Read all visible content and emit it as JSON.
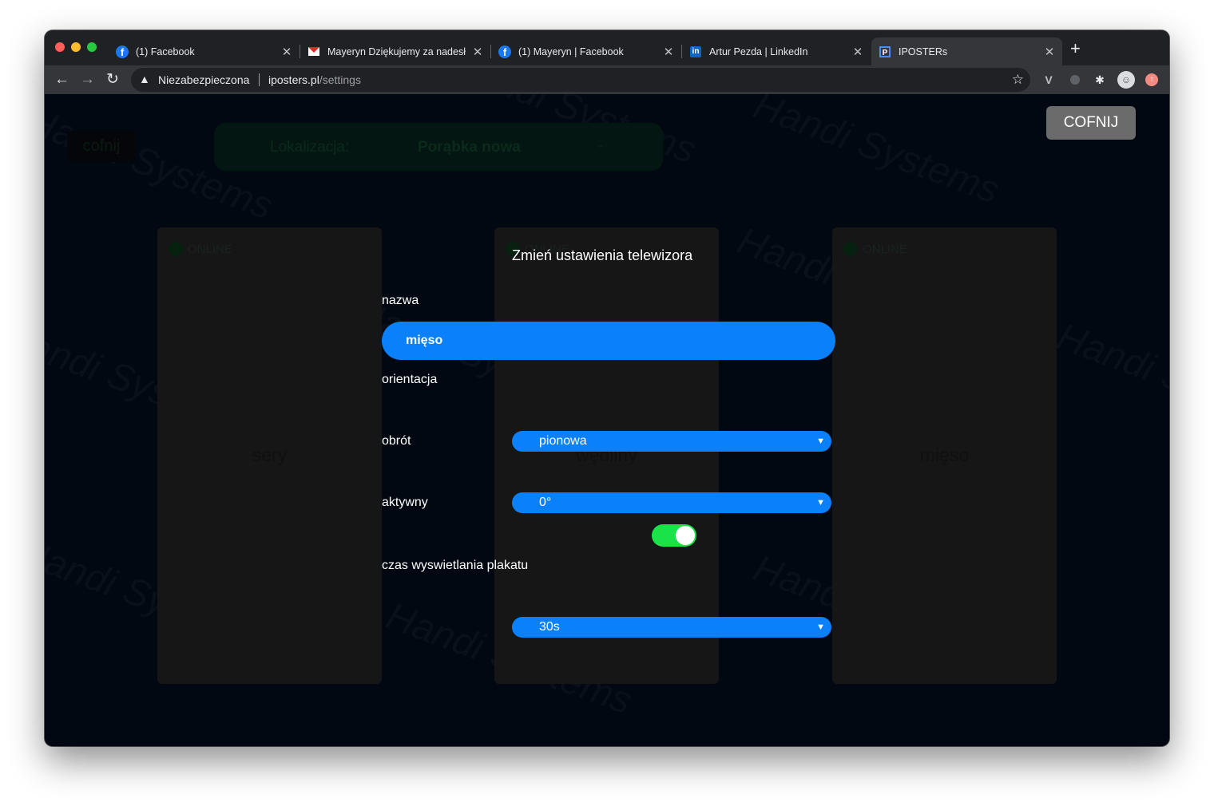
{
  "browser": {
    "tabs": [
      {
        "title": "(1) Facebook",
        "icon": "facebook-icon"
      },
      {
        "title": "Mayeryn Dziękujemy za nadesł",
        "icon": "gmail-icon"
      },
      {
        "title": "(1) Mayeryn | Facebook",
        "icon": "facebook-icon"
      },
      {
        "title": "Artur Pezda | LinkedIn",
        "icon": "linkedin-icon"
      },
      {
        "title": "IPOSTERs",
        "icon": "iposters-icon",
        "active": true
      }
    ],
    "security_label": "Niezabezpieczona",
    "url_host": "iposters.pl",
    "url_path": "/settings"
  },
  "background": {
    "back_label": "cofnij",
    "location_label": "Lokalizacja:",
    "location_value": "Porąbka nowa",
    "tvs": [
      {
        "status": "ONLINE",
        "name": "sery"
      },
      {
        "status": "ONLINE",
        "name": "wędliny"
      },
      {
        "status": "ONLINE",
        "name": "mięso"
      }
    ]
  },
  "cofnij_button": "COFNIJ",
  "modal": {
    "title": "Zmień ustawienia telewizora",
    "name_label": "nazwa",
    "name_value": "mięso",
    "orientation_label": "orientacja",
    "orientation_value": "pionowa",
    "rotation_label": "obrót",
    "rotation_value": "0°",
    "active_label": "aktywny",
    "active_on": true,
    "display_time_label": "czas wyswietlania plakatu",
    "display_time_value": "30s"
  },
  "colors": {
    "accent": "#0a80fb",
    "toggle_on": "#19e349",
    "page_bg": "#020812"
  }
}
